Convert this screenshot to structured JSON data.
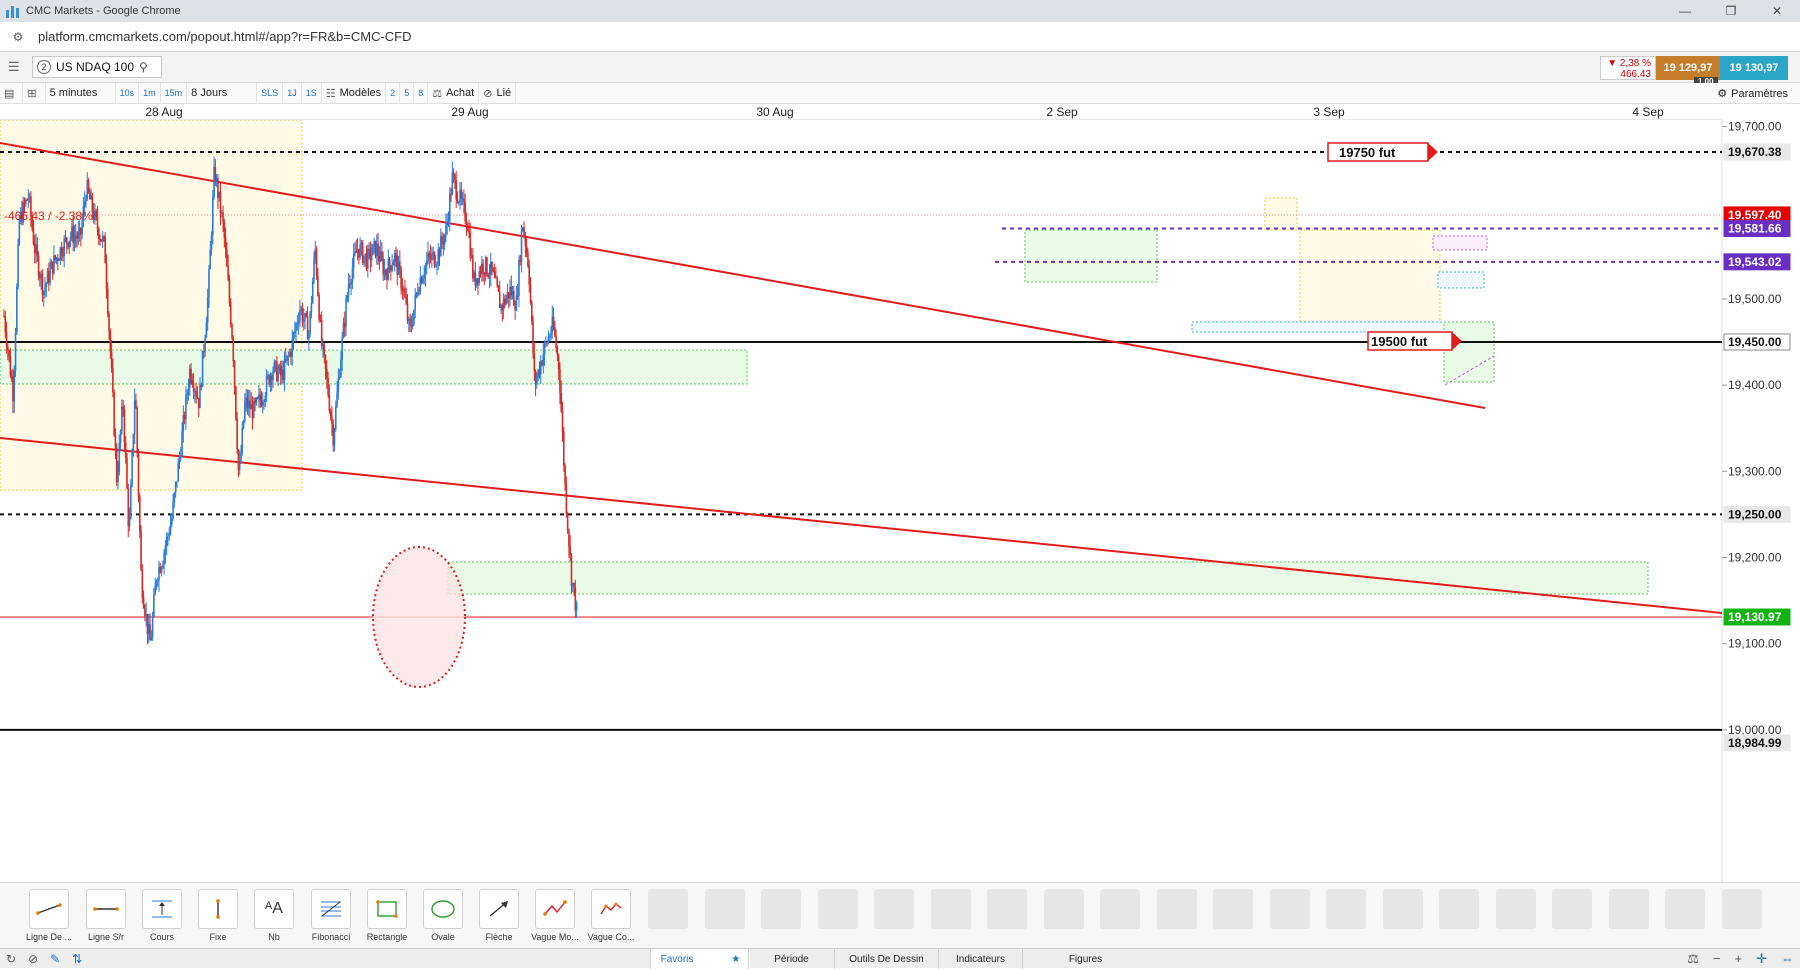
{
  "window": {
    "title": "CMC Markets - Google Chrome",
    "controls": [
      "—",
      "❐",
      "✕"
    ]
  },
  "browser": {
    "url": "platform.cmcmarkets.com/popout.html#/app?r=FR&b=CMC-CFD"
  },
  "instrument": {
    "badge": "2",
    "name": "US NDAQ 100",
    "change_pct": "▼ 2,38 %",
    "change_abs": "466.43",
    "sell": "19 129,97",
    "buy": "19 130,97",
    "spread": "1.00"
  },
  "toolbar": {
    "interval": "5 minutes",
    "quick_intervals": [
      "10s",
      "1m",
      "15m"
    ],
    "range": "8 Jours",
    "sls": "SLS",
    "one_j": "1J",
    "one_s": "1S",
    "modeles": "Modèles",
    "counts": [
      "2",
      "5",
      "8"
    ],
    "achat": "Achat",
    "lie": "Lié",
    "settings": "Paramètres"
  },
  "date_axis": [
    "28 Aug",
    "29 Aug",
    "30 Aug",
    "2 Sep",
    "3 Sep",
    "4 Sep"
  ],
  "price_axis": {
    "ticks": [
      "19,700.00",
      "19,500.00",
      "19,400.00",
      "19,300.00",
      "19,200.00",
      "19,100.00",
      "19,000.00"
    ],
    "tags": [
      {
        "text": "19,670.38",
        "bg": "#e8e8e8",
        "fg": "#111111"
      },
      {
        "text": "19,597.40",
        "bg": "#e60000",
        "fg": "#ffffff"
      },
      {
        "text": "19,581.66",
        "bg": "#6a2ec4",
        "fg": "#ffffff"
      },
      {
        "text": "19,543.02",
        "bg": "#6a2ec4",
        "fg": "#ffffff"
      },
      {
        "text": "19,450.00",
        "bg": "#ffffff",
        "fg": "#111111"
      },
      {
        "text": "19,250.00",
        "bg": "#e8e8e8",
        "fg": "#111111"
      },
      {
        "text": "19,130.97",
        "bg": "#12b312",
        "fg": "#ffffff"
      },
      {
        "text": "18,984.99",
        "bg": "#e8e8e8",
        "fg": "#111111"
      }
    ]
  },
  "annotations": {
    "fut_upper": "19750 fut",
    "fut_lower": "19500 fut",
    "change_label": "-466.43 / -2.38%"
  },
  "chart_data": {
    "type": "candlestick",
    "instrument": "US NDAQ 100",
    "timeframe": "5 minutes",
    "x": [
      "28 Aug",
      "29 Aug",
      "30 Aug",
      "2 Sep",
      "3 Sep",
      "4 Sep"
    ],
    "ylim": [
      18980,
      19760
    ],
    "close_path": [
      [
        0,
        19480
      ],
      [
        0.03,
        19390
      ],
      [
        0.05,
        19590
      ],
      [
        0.08,
        19620
      ],
      [
        0.1,
        19560
      ],
      [
        0.13,
        19510
      ],
      [
        0.16,
        19540
      ],
      [
        0.19,
        19560
      ],
      [
        0.22,
        19575
      ],
      [
        0.25,
        19570
      ],
      [
        0.27,
        19630
      ],
      [
        0.3,
        19590
      ],
      [
        0.33,
        19560
      ],
      [
        0.35,
        19430
      ],
      [
        0.37,
        19290
      ],
      [
        0.39,
        19380
      ],
      [
        0.41,
        19225
      ],
      [
        0.43,
        19400
      ],
      [
        0.45,
        19175
      ],
      [
        0.47,
        19120
      ],
      [
        0.48,
        19100
      ],
      [
        0.5,
        19180
      ],
      [
        0.52,
        19200
      ],
      [
        0.55,
        19245
      ],
      [
        0.58,
        19330
      ],
      [
        0.61,
        19420
      ],
      [
        0.64,
        19380
      ],
      [
        0.67,
        19510
      ],
      [
        0.69,
        19650
      ],
      [
        0.72,
        19580
      ],
      [
        0.75,
        19450
      ],
      [
        0.77,
        19290
      ],
      [
        0.79,
        19380
      ],
      [
        0.82,
        19370
      ],
      [
        0.85,
        19390
      ],
      [
        0.88,
        19420
      ],
      [
        0.91,
        19410
      ],
      [
        0.94,
        19440
      ],
      [
        0.97,
        19490
      ],
      [
        1.0,
        19460
      ],
      [
        1.02,
        19560
      ],
      [
        1.04,
        19450
      ],
      [
        1.06,
        19400
      ],
      [
        1.08,
        19340
      ],
      [
        1.1,
        19420
      ],
      [
        1.13,
        19520
      ],
      [
        1.16,
        19560
      ],
      [
        1.19,
        19545
      ],
      [
        1.22,
        19560
      ],
      [
        1.25,
        19530
      ],
      [
        1.28,
        19550
      ],
      [
        1.31,
        19510
      ],
      [
        1.33,
        19460
      ],
      [
        1.36,
        19520
      ],
      [
        1.39,
        19545
      ],
      [
        1.42,
        19550
      ],
      [
        1.45,
        19580
      ],
      [
        1.47,
        19640
      ],
      [
        1.5,
        19610
      ],
      [
        1.52,
        19590
      ],
      [
        1.54,
        19520
      ],
      [
        1.57,
        19540
      ],
      [
        1.6,
        19530
      ],
      [
        1.63,
        19490
      ],
      [
        1.66,
        19510
      ],
      [
        1.68,
        19495
      ],
      [
        1.7,
        19590
      ],
      [
        1.72,
        19540
      ],
      [
        1.74,
        19400
      ],
      [
        1.77,
        19440
      ],
      [
        1.8,
        19470
      ],
      [
        1.82,
        19420
      ],
      [
        1.84,
        19280
      ],
      [
        1.86,
        19180
      ],
      [
        1.88,
        19131
      ]
    ],
    "horizontal_levels": [
      19670.38,
      19597.4,
      19581.66,
      19543.02,
      19450.0,
      19250.0,
      19130.97,
      19000.0
    ],
    "resistance_labels": [
      "19750 fut",
      "19500 fut"
    ]
  }
}
